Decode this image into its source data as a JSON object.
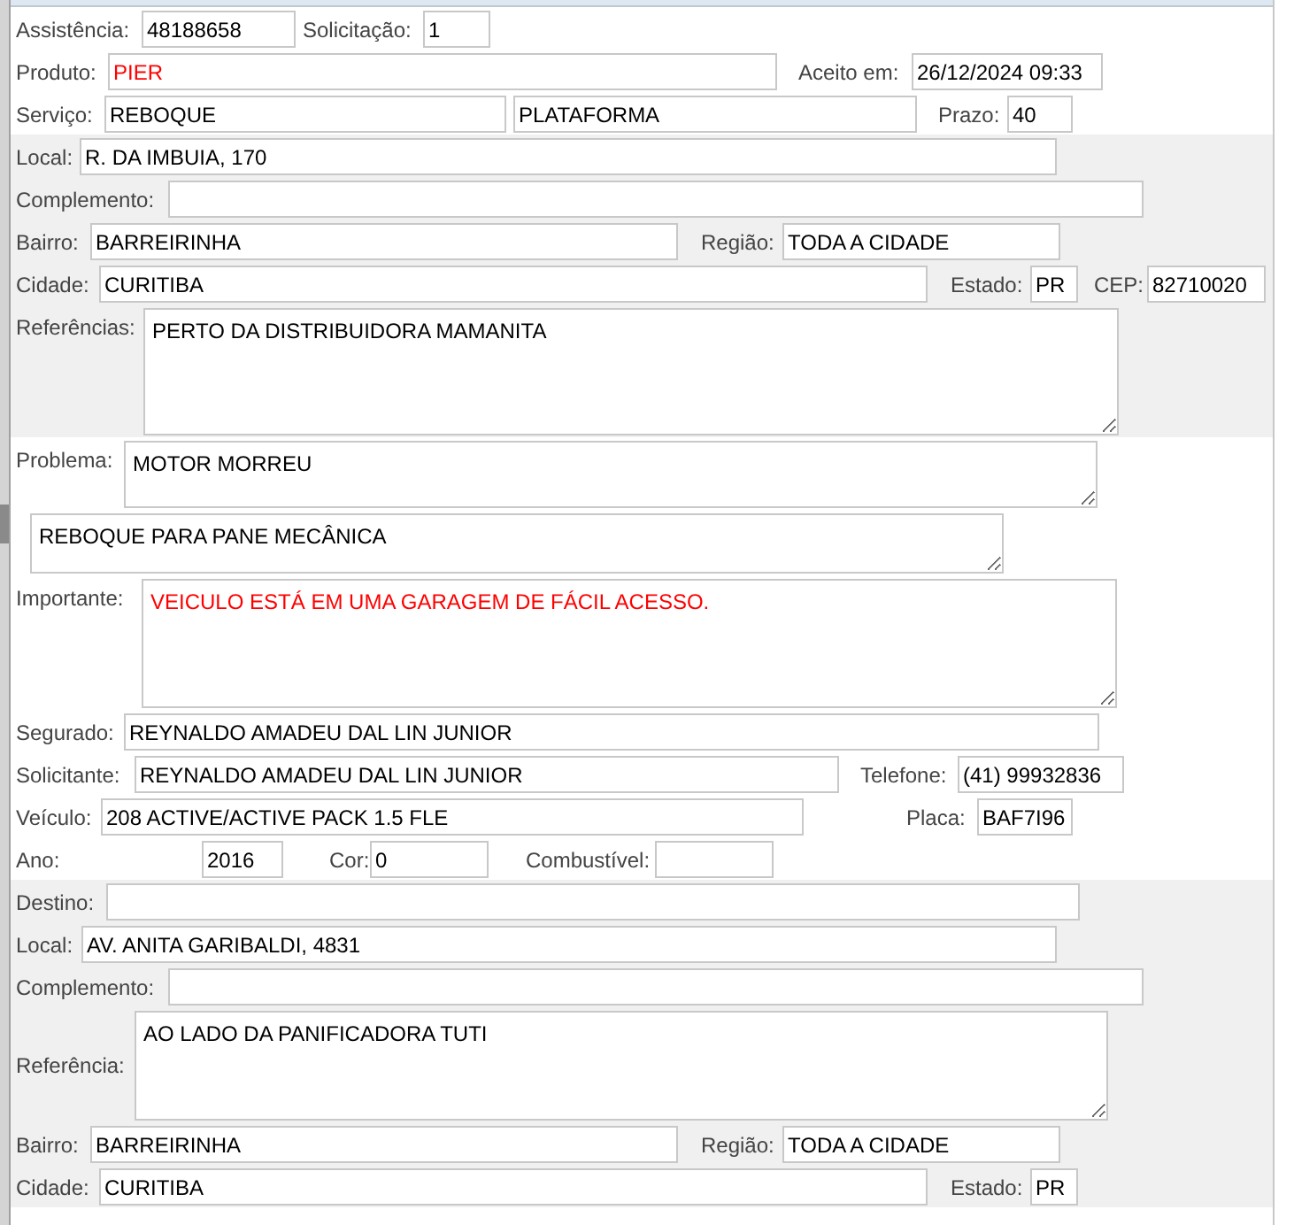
{
  "sections": [
    {
      "shaded": false,
      "rows": [
        {
          "fields": [
            {
              "kind": "label",
              "text": "Assistência:"
            },
            {
              "kind": "input",
              "value": "48188658",
              "alert": false
            },
            {
              "kind": "label",
              "text": "Solicitação:"
            },
            {
              "kind": "input",
              "value": "1",
              "alert": false
            }
          ]
        },
        {
          "fields": [
            {
              "kind": "label",
              "text": "Produto:"
            },
            {
              "kind": "input",
              "value": "PIER",
              "alert": true
            },
            {
              "kind": "label",
              "text": "Aceito em:"
            },
            {
              "kind": "input",
              "value": "26/12/2024 09:33",
              "alert": false
            }
          ]
        },
        {
          "fields": [
            {
              "kind": "label",
              "text": "Serviço:"
            },
            {
              "kind": "input",
              "value": "REBOQUE",
              "alert": false
            },
            {
              "kind": "input",
              "value": "PLATAFORMA",
              "alert": false
            },
            {
              "kind": "label",
              "text": "Prazo:"
            },
            {
              "kind": "input",
              "value": "40",
              "alert": false
            }
          ]
        }
      ]
    },
    {
      "shaded": true,
      "rows": [
        {
          "fields": [
            {
              "kind": "label",
              "text": "Local:"
            },
            {
              "kind": "input",
              "value": "R. DA IMBUIA, 170",
              "alert": false
            }
          ]
        },
        {
          "fields": [
            {
              "kind": "label",
              "text": "Complemento:"
            },
            {
              "kind": "input"
            }
          ]
        },
        {
          "fields": [
            {
              "kind": "label",
              "text": "Bairro:"
            },
            {
              "kind": "input",
              "value": "BARREIRINHA",
              "alert": false
            },
            {
              "kind": "label",
              "text": "Região:"
            },
            {
              "kind": "input",
              "value": "TODA A CIDADE",
              "alert": false
            }
          ]
        },
        {
          "fields": [
            {
              "kind": "label",
              "text": "Cidade:"
            },
            {
              "kind": "input",
              "value": "CURITIBA",
              "alert": false
            },
            {
              "kind": "label",
              "text": "Estado:"
            },
            {
              "kind": "input",
              "value": "PR",
              "alert": false
            },
            {
              "kind": "label",
              "text": "CEP:"
            },
            {
              "kind": "input",
              "value": "82710020",
              "alert": false
            }
          ]
        },
        {
          "fields": [
            {
              "kind": "label",
              "text": "Referências:"
            },
            {
              "kind": "textarea",
              "value": "PERTO DA DISTRIBUIDORA MAMANITA",
              "alert": false
            }
          ]
        }
      ]
    },
    {
      "shaded": false,
      "rows": [
        {
          "fields": [
            {
              "kind": "label",
              "text": "Problema:"
            },
            {
              "kind": "textarea",
              "value": "MOTOR MORREU",
              "alert": false
            }
          ]
        },
        {
          "fields": [
            {
              "kind": "textarea",
              "value": "REBOQUE PARA PANE MECÂNICA",
              "alert": false
            }
          ]
        },
        {
          "fields": [
            {
              "kind": "label",
              "text": "Importante:"
            },
            {
              "kind": "textarea",
              "value": "VEICULO ESTÁ EM UMA GARAGEM DE FÁCIL ACESSO.",
              "alert": true
            }
          ]
        },
        {
          "fields": [
            {
              "kind": "label",
              "text": "Segurado:"
            },
            {
              "kind": "input",
              "value": "REYNALDO AMADEU DAL LIN JUNIOR",
              "alert": false
            }
          ]
        },
        {
          "fields": [
            {
              "kind": "label",
              "text": "Solicitante:"
            },
            {
              "kind": "input",
              "value": "REYNALDO AMADEU DAL LIN JUNIOR",
              "alert": false
            },
            {
              "kind": "label",
              "text": "Telefone:"
            },
            {
              "kind": "input",
              "value": "(41) 99932836",
              "alert": false
            }
          ]
        },
        {
          "fields": [
            {
              "kind": "label",
              "text": "Veículo:"
            },
            {
              "kind": "input",
              "value": "208 ACTIVE/ACTIVE PACK 1.5 FLE",
              "alert": false
            },
            {
              "kind": "label",
              "text": "Placa:"
            },
            {
              "kind": "input",
              "value": "BAF7I96",
              "alert": false
            }
          ]
        },
        {
          "fields": [
            {
              "kind": "label",
              "text": "Ano:"
            },
            {
              "kind": "input",
              "value": "2016",
              "alert": false
            },
            {
              "kind": "label",
              "text": "Cor:"
            },
            {
              "kind": "input",
              "value": "0",
              "alert": false
            },
            {
              "kind": "label",
              "text": "Combustível:"
            },
            {
              "kind": "input"
            }
          ]
        }
      ]
    },
    {
      "shaded": true,
      "rows": [
        {
          "fields": [
            {
              "kind": "label",
              "text": "Destino:"
            },
            {
              "kind": "input"
            }
          ]
        },
        {
          "fields": [
            {
              "kind": "label",
              "text": "Local:"
            },
            {
              "kind": "input",
              "value": "AV. ANITA GARIBALDI, 4831",
              "alert": false
            }
          ]
        },
        {
          "fields": [
            {
              "kind": "label",
              "text": "Complemento:"
            },
            {
              "kind": "input"
            }
          ]
        },
        {
          "fields": [
            {
              "kind": "label",
              "text": "Referência:"
            },
            {
              "kind": "textarea",
              "value": "AO LADO DA PANIFICADORA TUTI",
              "alert": false
            }
          ]
        },
        {
          "fields": [
            {
              "kind": "label",
              "text": "Bairro:"
            },
            {
              "kind": "input",
              "value": "BARREIRINHA",
              "alert": false
            },
            {
              "kind": "label",
              "text": "Região:"
            },
            {
              "kind": "input",
              "value": "TODA A CIDADE",
              "alert": false
            }
          ]
        },
        {
          "fields": [
            {
              "kind": "label",
              "text": "Cidade:"
            },
            {
              "kind": "input",
              "value": "CURITIBA",
              "alert": false
            },
            {
              "kind": "label",
              "text": "Estado:"
            },
            {
              "kind": "input",
              "value": "PR",
              "alert": false
            }
          ]
        }
      ]
    }
  ]
}
